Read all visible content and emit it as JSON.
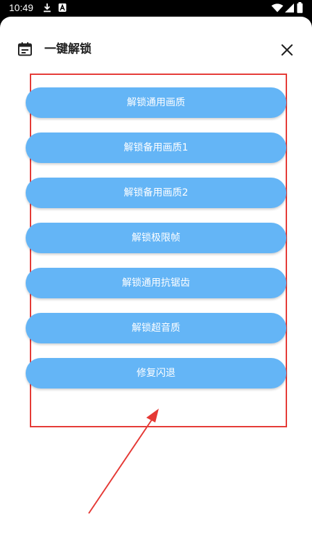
{
  "status_bar": {
    "time": "10:49"
  },
  "header": {
    "title": "一键解锁",
    "icon": "calendar-icon",
    "close_icon": "close-icon"
  },
  "buttons": [
    {
      "label": "解锁通用画质"
    },
    {
      "label": "解锁备用画质1"
    },
    {
      "label": "解锁备用画质2"
    },
    {
      "label": "解锁极限帧"
    },
    {
      "label": "解锁通用抗锯齿"
    },
    {
      "label": "解锁超音质"
    },
    {
      "label": "修复闪退"
    }
  ],
  "colors": {
    "button_bg": "#64b5f6",
    "highlight": "#e53935",
    "arrow": "#e53935"
  }
}
